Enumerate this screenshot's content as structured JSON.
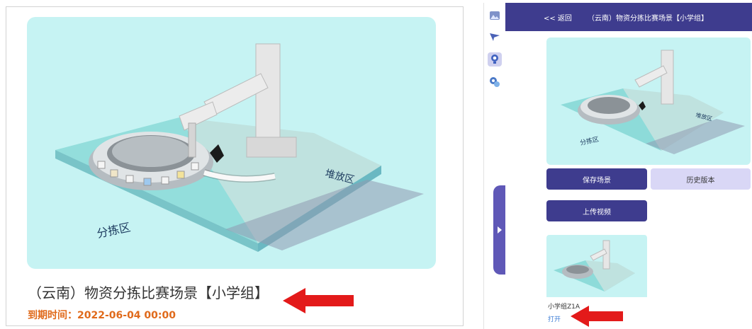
{
  "left_card": {
    "title": "（云南）物资分拣比赛场景【小学组】",
    "expiry": "到期时间：2022-06-04 00:00",
    "scene_labels": {
      "sort_zone": "分拣区",
      "stack_zone": "堆放区"
    }
  },
  "right_panel": {
    "header": {
      "back_label": "<< 返回",
      "title": "（云南）物资分拣比赛场景【小学组】"
    },
    "rail_icons": [
      "image-icon",
      "send-icon",
      "trophy-icon",
      "settings-icon"
    ],
    "buttons": {
      "save": "保存场景",
      "history": "历史版本",
      "upload": "上传视频"
    },
    "video": {
      "name": "小学组Z1A",
      "open_label": "打开"
    }
  },
  "colors": {
    "primary": "#3e3c8e",
    "secondary": "#d9d7f6",
    "thumb_bg": "#c6f3f3",
    "expiry": "#e06a1b",
    "arrow": "#e31a1a"
  }
}
